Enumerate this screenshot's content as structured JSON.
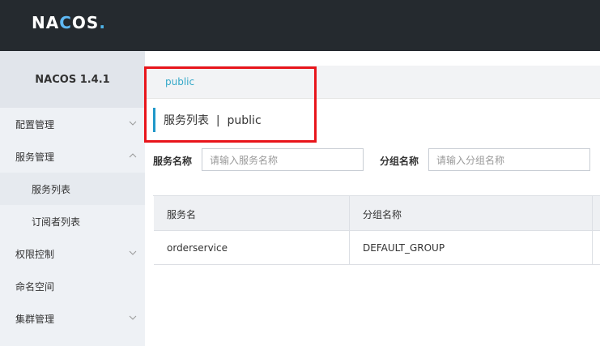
{
  "brand": {
    "logo_text_1": "NA",
    "logo_text_c": "C",
    "logo_text_2": "OS",
    "logo_dot": "."
  },
  "sidebar": {
    "version": "NACOS 1.4.1",
    "items": [
      {
        "label": "配置管理",
        "icon": "chevron-down-icon"
      },
      {
        "label": "服务管理",
        "icon": "chevron-up-icon"
      },
      {
        "label": "服务列表"
      },
      {
        "label": "订阅者列表"
      },
      {
        "label": "权限控制",
        "icon": "chevron-down-icon"
      },
      {
        "label": "命名空间"
      },
      {
        "label": "集群管理",
        "icon": "chevron-down-icon"
      }
    ]
  },
  "namespace_bar": {
    "current": "public"
  },
  "page": {
    "title": "服务列表  |  public"
  },
  "filters": {
    "service_name_label": "服务名称",
    "service_name_placeholder": "请输入服务名称",
    "group_name_label": "分组名称",
    "group_name_placeholder": "请输入分组名称"
  },
  "table": {
    "headers": [
      "服务名",
      "分组名称"
    ],
    "rows": [
      [
        "orderservice",
        "DEFAULT_GROUP"
      ]
    ]
  },
  "colors": {
    "highlight_box": "#e8151b",
    "accent": "#2097c9",
    "topbar": "#252a2f"
  }
}
